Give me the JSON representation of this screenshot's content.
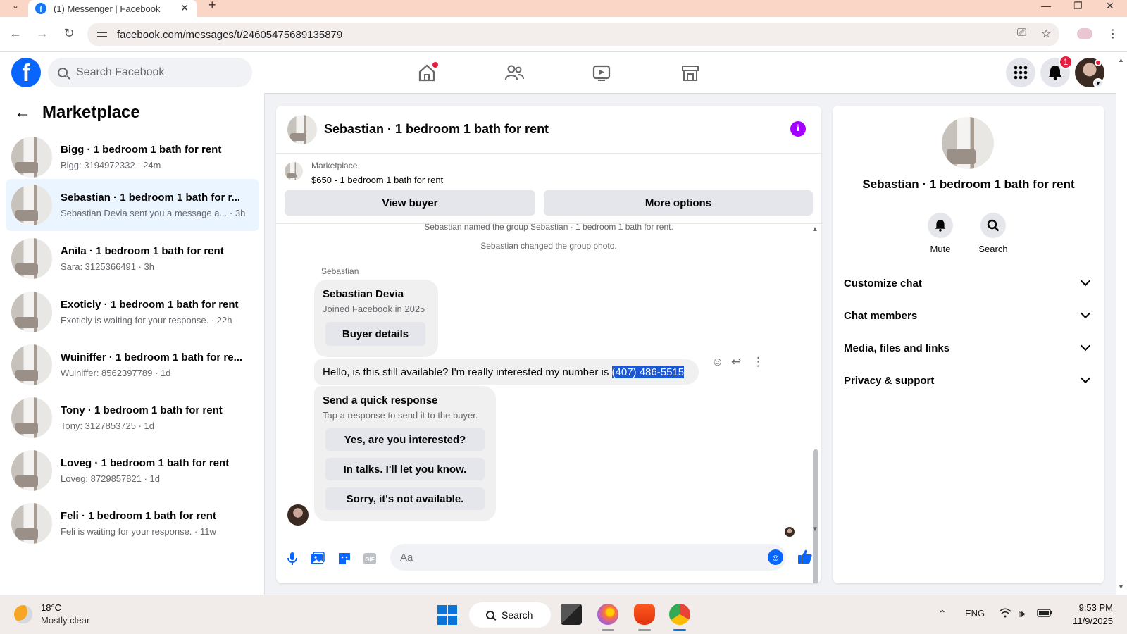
{
  "browser": {
    "tab_title": "(1) Messenger | Facebook",
    "url": "facebook.com/messages/t/24605475689135879"
  },
  "header": {
    "search_placeholder": "Search Facebook",
    "notification_count": "1"
  },
  "sidebar": {
    "title": "Marketplace",
    "conversations": [
      {
        "name": "Bigg · 1 bedroom 1 bath for rent",
        "preview": "Bigg: 3194972332 · 24m"
      },
      {
        "name": "Sebastian · 1 bedroom 1 bath for r...",
        "preview": "Sebastian Devia sent you a message a... · 3h"
      },
      {
        "name": "Anila · 1 bedroom 1 bath for rent",
        "preview": "Sara: 3125366491 · 3h"
      },
      {
        "name": "Exoticly · 1 bedroom 1 bath for rent",
        "preview": "Exoticly is waiting for your response. · 22h"
      },
      {
        "name": "Wuiniffer · 1 bedroom 1 bath for re...",
        "preview": "Wuiniffer: 8562397789 · 1d"
      },
      {
        "name": "Tony · 1 bedroom 1 bath for rent",
        "preview": "Tony: 3127853725 · 1d"
      },
      {
        "name": "Loveg · 1 bedroom 1 bath for rent",
        "preview": "Loveg: 8729857821 · 1d"
      },
      {
        "name": "Feli · 1 bedroom 1 bath for rent",
        "preview": "Feli is waiting for your response. · 11w"
      }
    ]
  },
  "chat": {
    "title": "Sebastian · 1 bedroom 1 bath for rent",
    "marketplace_label": "Marketplace",
    "listing": "$650 - 1 bedroom 1 bath for rent",
    "view_buyer": "View buyer",
    "more_options": "More options",
    "sys_1": "Sebastian named the group Sebastian · 1 bedroom 1 bath for rent.",
    "sys_2": "Sebastian changed the group photo.",
    "sender": "Sebastian",
    "card_name": "Sebastian Devia",
    "card_sub": "Joined Facebook in 2025",
    "buyer_details": "Buyer details",
    "message_prefix": "Hello, is this still available? I'm really interested my number is ",
    "message_phone": "(407) 486-5515",
    "quick_title": "Send a quick response",
    "quick_sub": "Tap a response to send it to the buyer.",
    "quick_1": "Yes, are you interested?",
    "quick_2": "In talks. I'll let you know.",
    "quick_3": "Sorry, it's not available.",
    "composer_placeholder": "Aa"
  },
  "details": {
    "title": "Sebastian · 1 bedroom 1 bath for rent",
    "mute": "Mute",
    "search": "Search",
    "sections": [
      "Customize chat",
      "Chat members",
      "Media, files and links",
      "Privacy & support"
    ]
  },
  "taskbar": {
    "temp": "18°C",
    "condition": "Mostly clear",
    "search": "Search",
    "lang": "ENG",
    "time": "9:53 PM",
    "date": "11/9/2025"
  },
  "colors": {
    "fb_blue": "#0866ff",
    "active_row": "#ebf5ff",
    "info_purple": "#a300ff"
  }
}
